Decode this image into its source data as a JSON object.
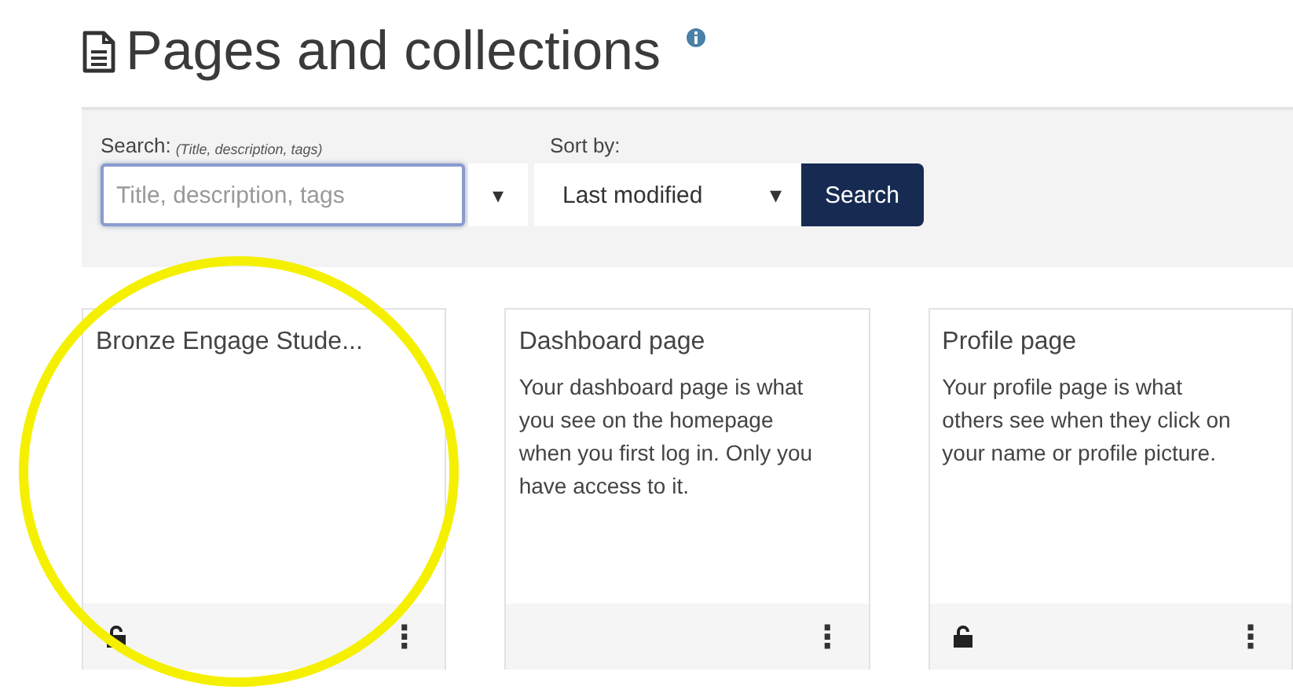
{
  "header": {
    "title": "Pages and collections"
  },
  "search": {
    "label": "Search:",
    "hint": "(Title, description, tags)",
    "placeholder": "Title, description, tags",
    "focused": true,
    "dropdown_caret": "▾",
    "sort_label": "Sort by:",
    "sort_value": "Last modified",
    "sort_caret": "▾",
    "button": "Search"
  },
  "cards": [
    {
      "title": "Bronze Engage Stude...",
      "lock_icon": true,
      "menu": "⋮"
    },
    {
      "title": "Dashboard page",
      "description": "Your dashboard page is what you see on the homepage when you first log in. Only you have access to it.",
      "lock_icon": false,
      "menu": "⋮"
    },
    {
      "title": "Profile page",
      "description": "Your profile page is what others see when they click on your name or profile picture.",
      "lock_icon": true,
      "menu": "⋮"
    }
  ],
  "annotation": {
    "kind": "circle"
  }
}
